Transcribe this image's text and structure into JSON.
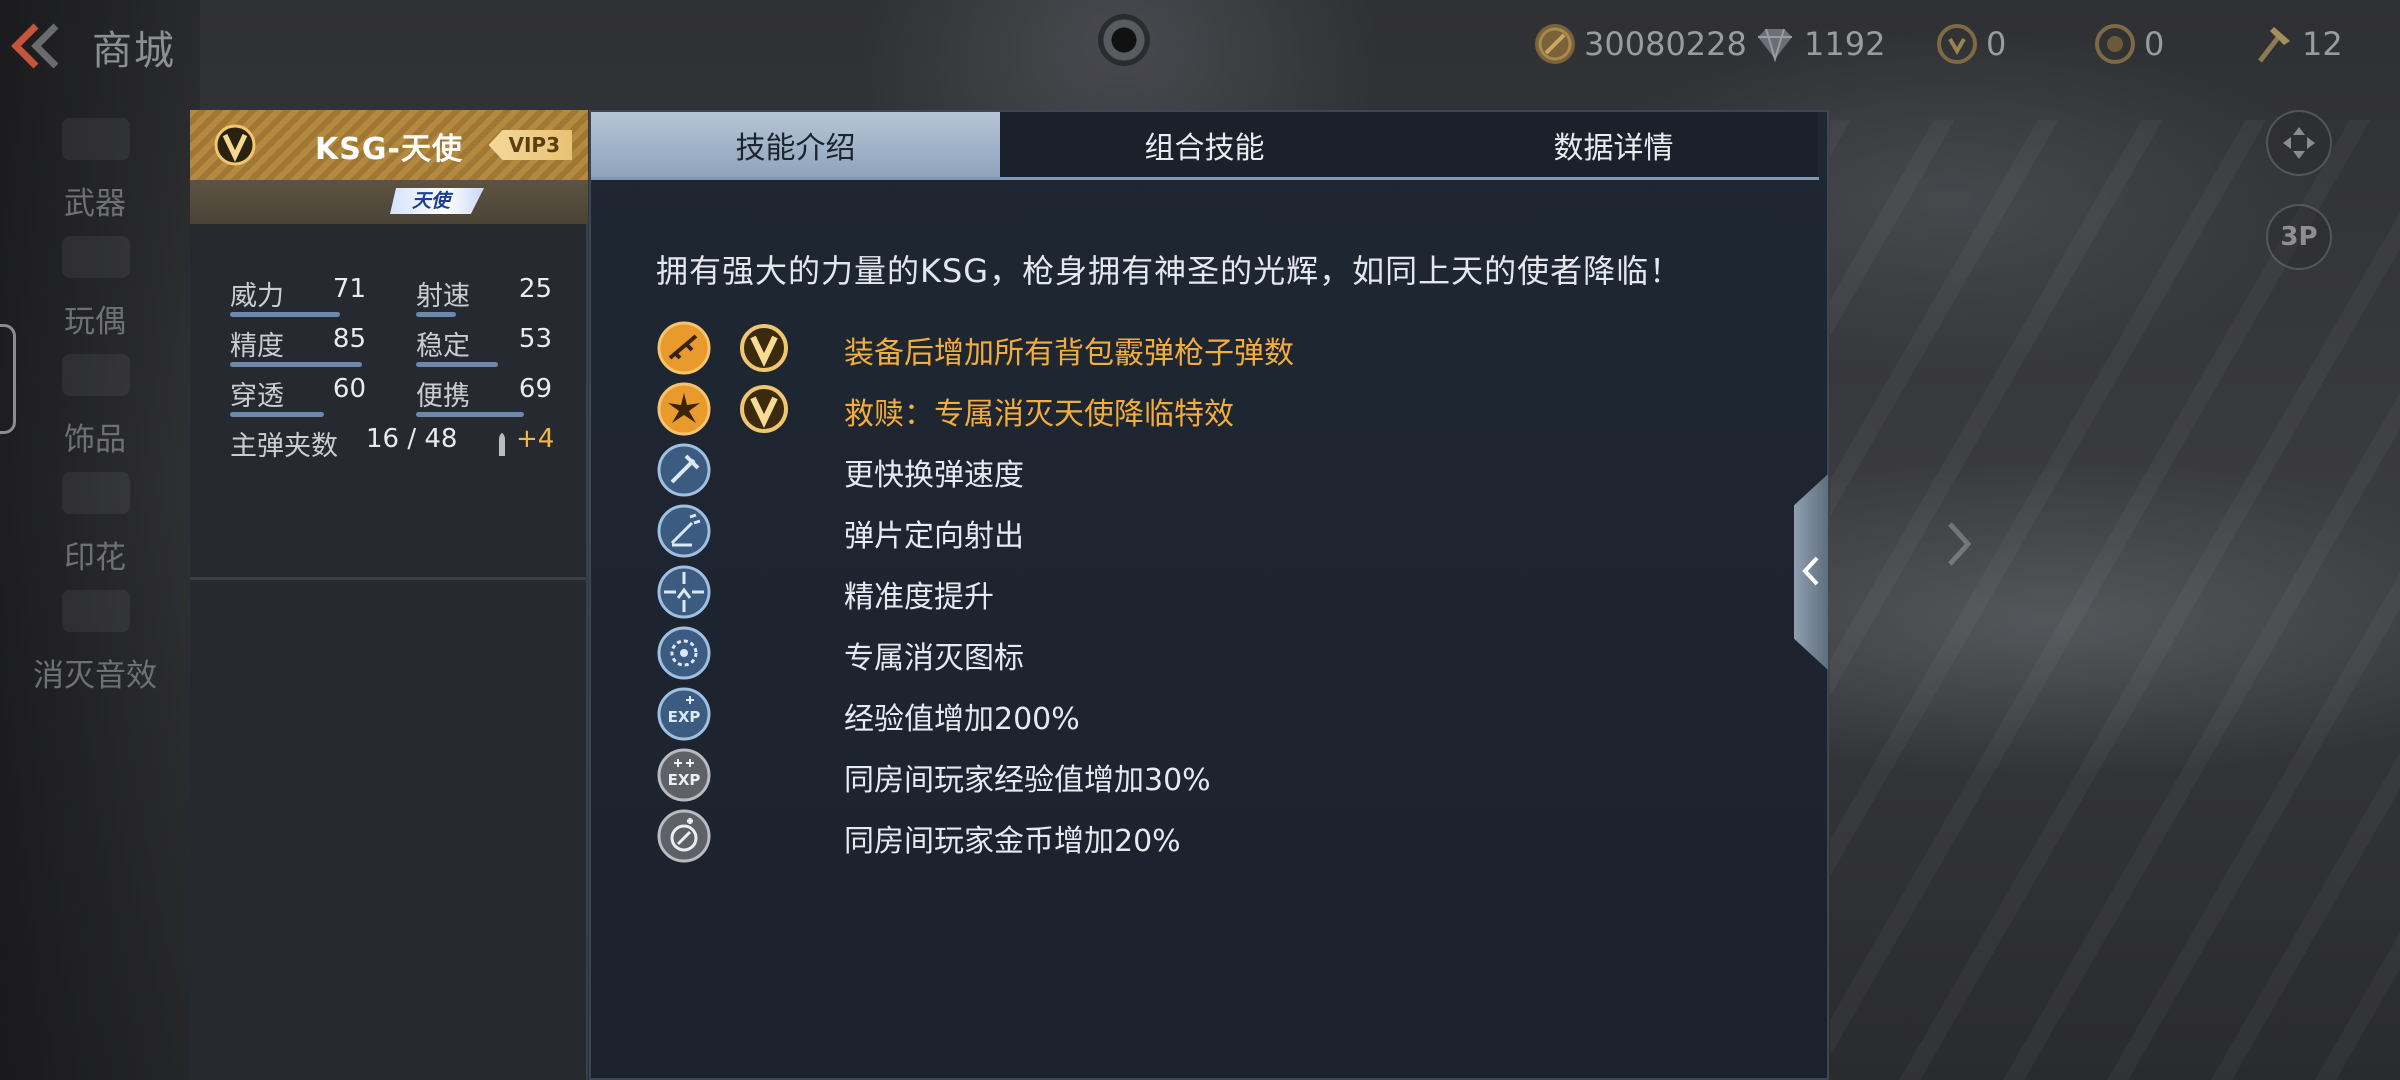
{
  "header": {
    "title": "商城",
    "currencies": [
      {
        "icon": "coin-icon",
        "value": "30080228"
      },
      {
        "icon": "diamond-icon",
        "value": "1192"
      },
      {
        "icon": "medal-icon",
        "value": "0"
      },
      {
        "icon": "token-icon",
        "value": "0"
      },
      {
        "icon": "hammer-icon",
        "value": "12"
      }
    ]
  },
  "categories": [
    "武器",
    "玩偶",
    "饰品",
    "印花",
    "消灭音效"
  ],
  "weapon": {
    "name": "KSG-天使",
    "vip": "VIP3",
    "tag": "天使",
    "stats": [
      {
        "label": "威力",
        "value": "71"
      },
      {
        "label": "射速",
        "value": "25"
      },
      {
        "label": "精度",
        "value": "85"
      },
      {
        "label": "稳定",
        "value": "53"
      },
      {
        "label": "穿透",
        "value": "60"
      },
      {
        "label": "便携",
        "value": "69"
      }
    ],
    "ammo": {
      "label": "主弹夹数",
      "value": "16 / 48",
      "bonus": "+4"
    }
  },
  "tabs": [
    "技能介绍",
    "组合技能",
    "数据详情"
  ],
  "active_tab": 0,
  "description": "拥有强大的力量的KSG，枪身拥有神圣的光辉，如同上天的使者降临！",
  "skills": [
    {
      "icon": "rifle-skill-icon",
      "vip": true,
      "text": "装备后增加所有背包霰弹枪子弹数",
      "highlight": true
    },
    {
      "icon": "burst-skill-icon",
      "vip": true,
      "text": "救赎：专属消灭天使降临特效",
      "highlight": true
    },
    {
      "icon": "reload-skill-icon",
      "vip": false,
      "text": "更快换弹速度",
      "highlight": false
    },
    {
      "icon": "spread-skill-icon",
      "vip": false,
      "text": "弹片定向射出",
      "highlight": false
    },
    {
      "icon": "crosshair-skill-icon",
      "vip": false,
      "text": "精准度提升",
      "highlight": false
    },
    {
      "icon": "kill-icon-skill-icon",
      "vip": false,
      "text": "专属消灭图标",
      "highlight": false
    },
    {
      "icon": "exp-skill-icon",
      "vip": false,
      "text": "经验值增加200%",
      "highlight": false
    },
    {
      "icon": "room-exp-skill-icon",
      "vip": false,
      "text": "同房间玩家经验值增加30%",
      "highlight": false
    },
    {
      "icon": "room-coin-skill-icon",
      "vip": false,
      "text": "同房间玩家金币增加20%",
      "highlight": false
    }
  ],
  "view_buttons": {
    "camera_label": "3P"
  },
  "colors": {
    "gold": "#f2ad3d",
    "tab_active": "#a9b9cc",
    "panel": "#1e2531"
  }
}
